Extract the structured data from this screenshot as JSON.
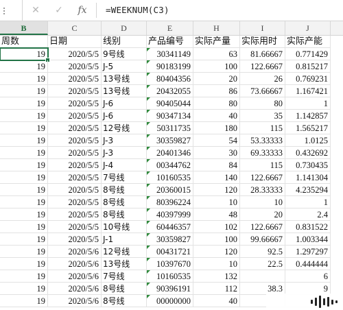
{
  "formula_bar": {
    "cancel_icon": "✕",
    "enter_icon": "✓",
    "fx_label": "fx",
    "formula": "=WEEKNUM(C3)"
  },
  "columns": [
    {
      "letter": "B",
      "active": true
    },
    {
      "letter": "C",
      "active": false
    },
    {
      "letter": "D",
      "active": false
    },
    {
      "letter": "E",
      "active": false
    },
    {
      "letter": "H",
      "active": false
    },
    {
      "letter": "I",
      "active": false
    },
    {
      "letter": "J",
      "active": false
    }
  ],
  "header_row": [
    "周数",
    "日期",
    "线别",
    "产品编号",
    "实际产量",
    "实际用时",
    "实际产能"
  ],
  "rows": [
    [
      "19",
      "2020/5/5",
      "9号线",
      "30341149",
      "63",
      "81.66667",
      "0.771429"
    ],
    [
      "19",
      "2020/5/5",
      "J-5",
      "90183199",
      "100",
      "122.6667",
      "0.815217"
    ],
    [
      "19",
      "2020/5/5",
      "13号线",
      "80404356",
      "20",
      "26",
      "0.769231"
    ],
    [
      "19",
      "2020/5/5",
      "13号线",
      "20432055",
      "86",
      "73.66667",
      "1.167421"
    ],
    [
      "19",
      "2020/5/5",
      "J-6",
      "90405044",
      "80",
      "80",
      "1"
    ],
    [
      "19",
      "2020/5/5",
      "J-6",
      "90347134",
      "40",
      "35",
      "1.142857"
    ],
    [
      "19",
      "2020/5/5",
      "12号线",
      "50311735",
      "180",
      "115",
      "1.565217"
    ],
    [
      "19",
      "2020/5/5",
      "J-3",
      "30359827",
      "54",
      "53.33333",
      "1.0125"
    ],
    [
      "19",
      "2020/5/5",
      "J-3",
      "20401346",
      "30",
      "69.33333",
      "0.432692"
    ],
    [
      "19",
      "2020/5/5",
      "J-4",
      "00344762",
      "84",
      "115",
      "0.730435"
    ],
    [
      "19",
      "2020/5/5",
      "7号线",
      "10160535",
      "140",
      "122.6667",
      "1.141304"
    ],
    [
      "19",
      "2020/5/5",
      "8号线",
      "20360015",
      "120",
      "28.33333",
      "4.235294"
    ],
    [
      "19",
      "2020/5/5",
      "8号线",
      "80396224",
      "10",
      "10",
      "1"
    ],
    [
      "19",
      "2020/5/5",
      "8号线",
      "40397999",
      "48",
      "20",
      "2.4"
    ],
    [
      "19",
      "2020/5/5",
      "10号线",
      "60446357",
      "102",
      "122.6667",
      "0.831522"
    ],
    [
      "19",
      "2020/5/5",
      "J-1",
      "30359827",
      "100",
      "99.66667",
      "1.003344"
    ],
    [
      "19",
      "2020/5/6",
      "12号线",
      "00431721",
      "120",
      "92.5",
      "1.297297"
    ],
    [
      "19",
      "2020/5/6",
      "13号线",
      "10397670",
      "10",
      "22.5",
      "0.444444"
    ],
    [
      "19",
      "2020/5/6",
      "7号线",
      "10160535",
      "132",
      "",
      "6"
    ],
    [
      "19",
      "2020/5/6",
      "8号线",
      "90396191",
      "112",
      "38.3",
      "9"
    ],
    [
      "19",
      "2020/5/6",
      "8号线",
      "00000000",
      "40",
      "",
      ""
    ]
  ],
  "watermark_icon": "audio-bars-icon",
  "accent_color": "#217346",
  "error_triangle_color": "#2f8a3c"
}
